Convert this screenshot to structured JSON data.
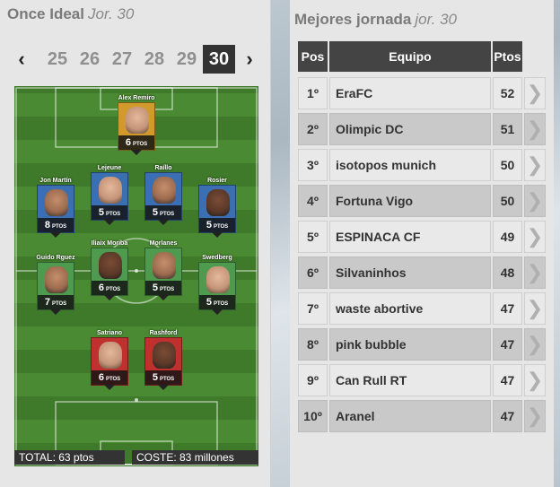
{
  "once_ideal": {
    "title": "Once Ideal",
    "subtitle": "Jor. 30",
    "prev_arrow": "‹",
    "next_arrow": "›",
    "rounds": [
      "25",
      "26",
      "27",
      "28",
      "29",
      "30"
    ],
    "active_round": "30",
    "pts_unit": "PTOS",
    "players": [
      {
        "name": "Alex Remiro",
        "points": "6",
        "color": "#d19a2a"
      },
      {
        "name": "Jon Martín",
        "points": "8",
        "color": "#3b6fb3"
      },
      {
        "name": "Lejeune",
        "points": "5",
        "color": "#3b6fb3"
      },
      {
        "name": "Raíllo",
        "points": "5",
        "color": "#3b6fb3"
      },
      {
        "name": "Rosier",
        "points": "5",
        "color": "#3b6fb3"
      },
      {
        "name": "Guido Rguez",
        "points": "7",
        "color": "#4e9a4e"
      },
      {
        "name": "Iliaix Moriba",
        "points": "6",
        "color": "#4e9a4e"
      },
      {
        "name": "Morlanes",
        "points": "5",
        "color": "#4e9a4e"
      },
      {
        "name": "Swedberg",
        "points": "5",
        "color": "#4e9a4e"
      },
      {
        "name": "Satriano",
        "points": "6",
        "color": "#c0302e"
      },
      {
        "name": "Rashford",
        "points": "5",
        "color": "#c0302e"
      }
    ],
    "total": "TOTAL: 63 ptos",
    "cost": "COSTE: 83 millones"
  },
  "mejores": {
    "title": "Mejores jornada",
    "subtitle": "jor. 30",
    "headers": {
      "pos": "Pos",
      "team": "Equipo",
      "pts": "Ptos"
    },
    "go_arrow": "❯",
    "rows": [
      {
        "pos": "1º",
        "team": "EraFC",
        "pts": "52"
      },
      {
        "pos": "2º",
        "team": "Olimpic DC",
        "pts": "51"
      },
      {
        "pos": "3º",
        "team": "isotopos munich",
        "pts": "50"
      },
      {
        "pos": "4º",
        "team": "Fortuna Vigo",
        "pts": "50"
      },
      {
        "pos": "5º",
        "team": "ESPINACA CF",
        "pts": "49"
      },
      {
        "pos": "6º",
        "team": "Silvaninhos",
        "pts": "48"
      },
      {
        "pos": "7º",
        "team": "waste abortive",
        "pts": "47"
      },
      {
        "pos": "8º",
        "team": "pink bubble",
        "pts": "47"
      },
      {
        "pos": "9º",
        "team": "Can Rull RT",
        "pts": "47"
      },
      {
        "pos": "10º",
        "team": "Aranel",
        "pts": "47"
      }
    ]
  }
}
